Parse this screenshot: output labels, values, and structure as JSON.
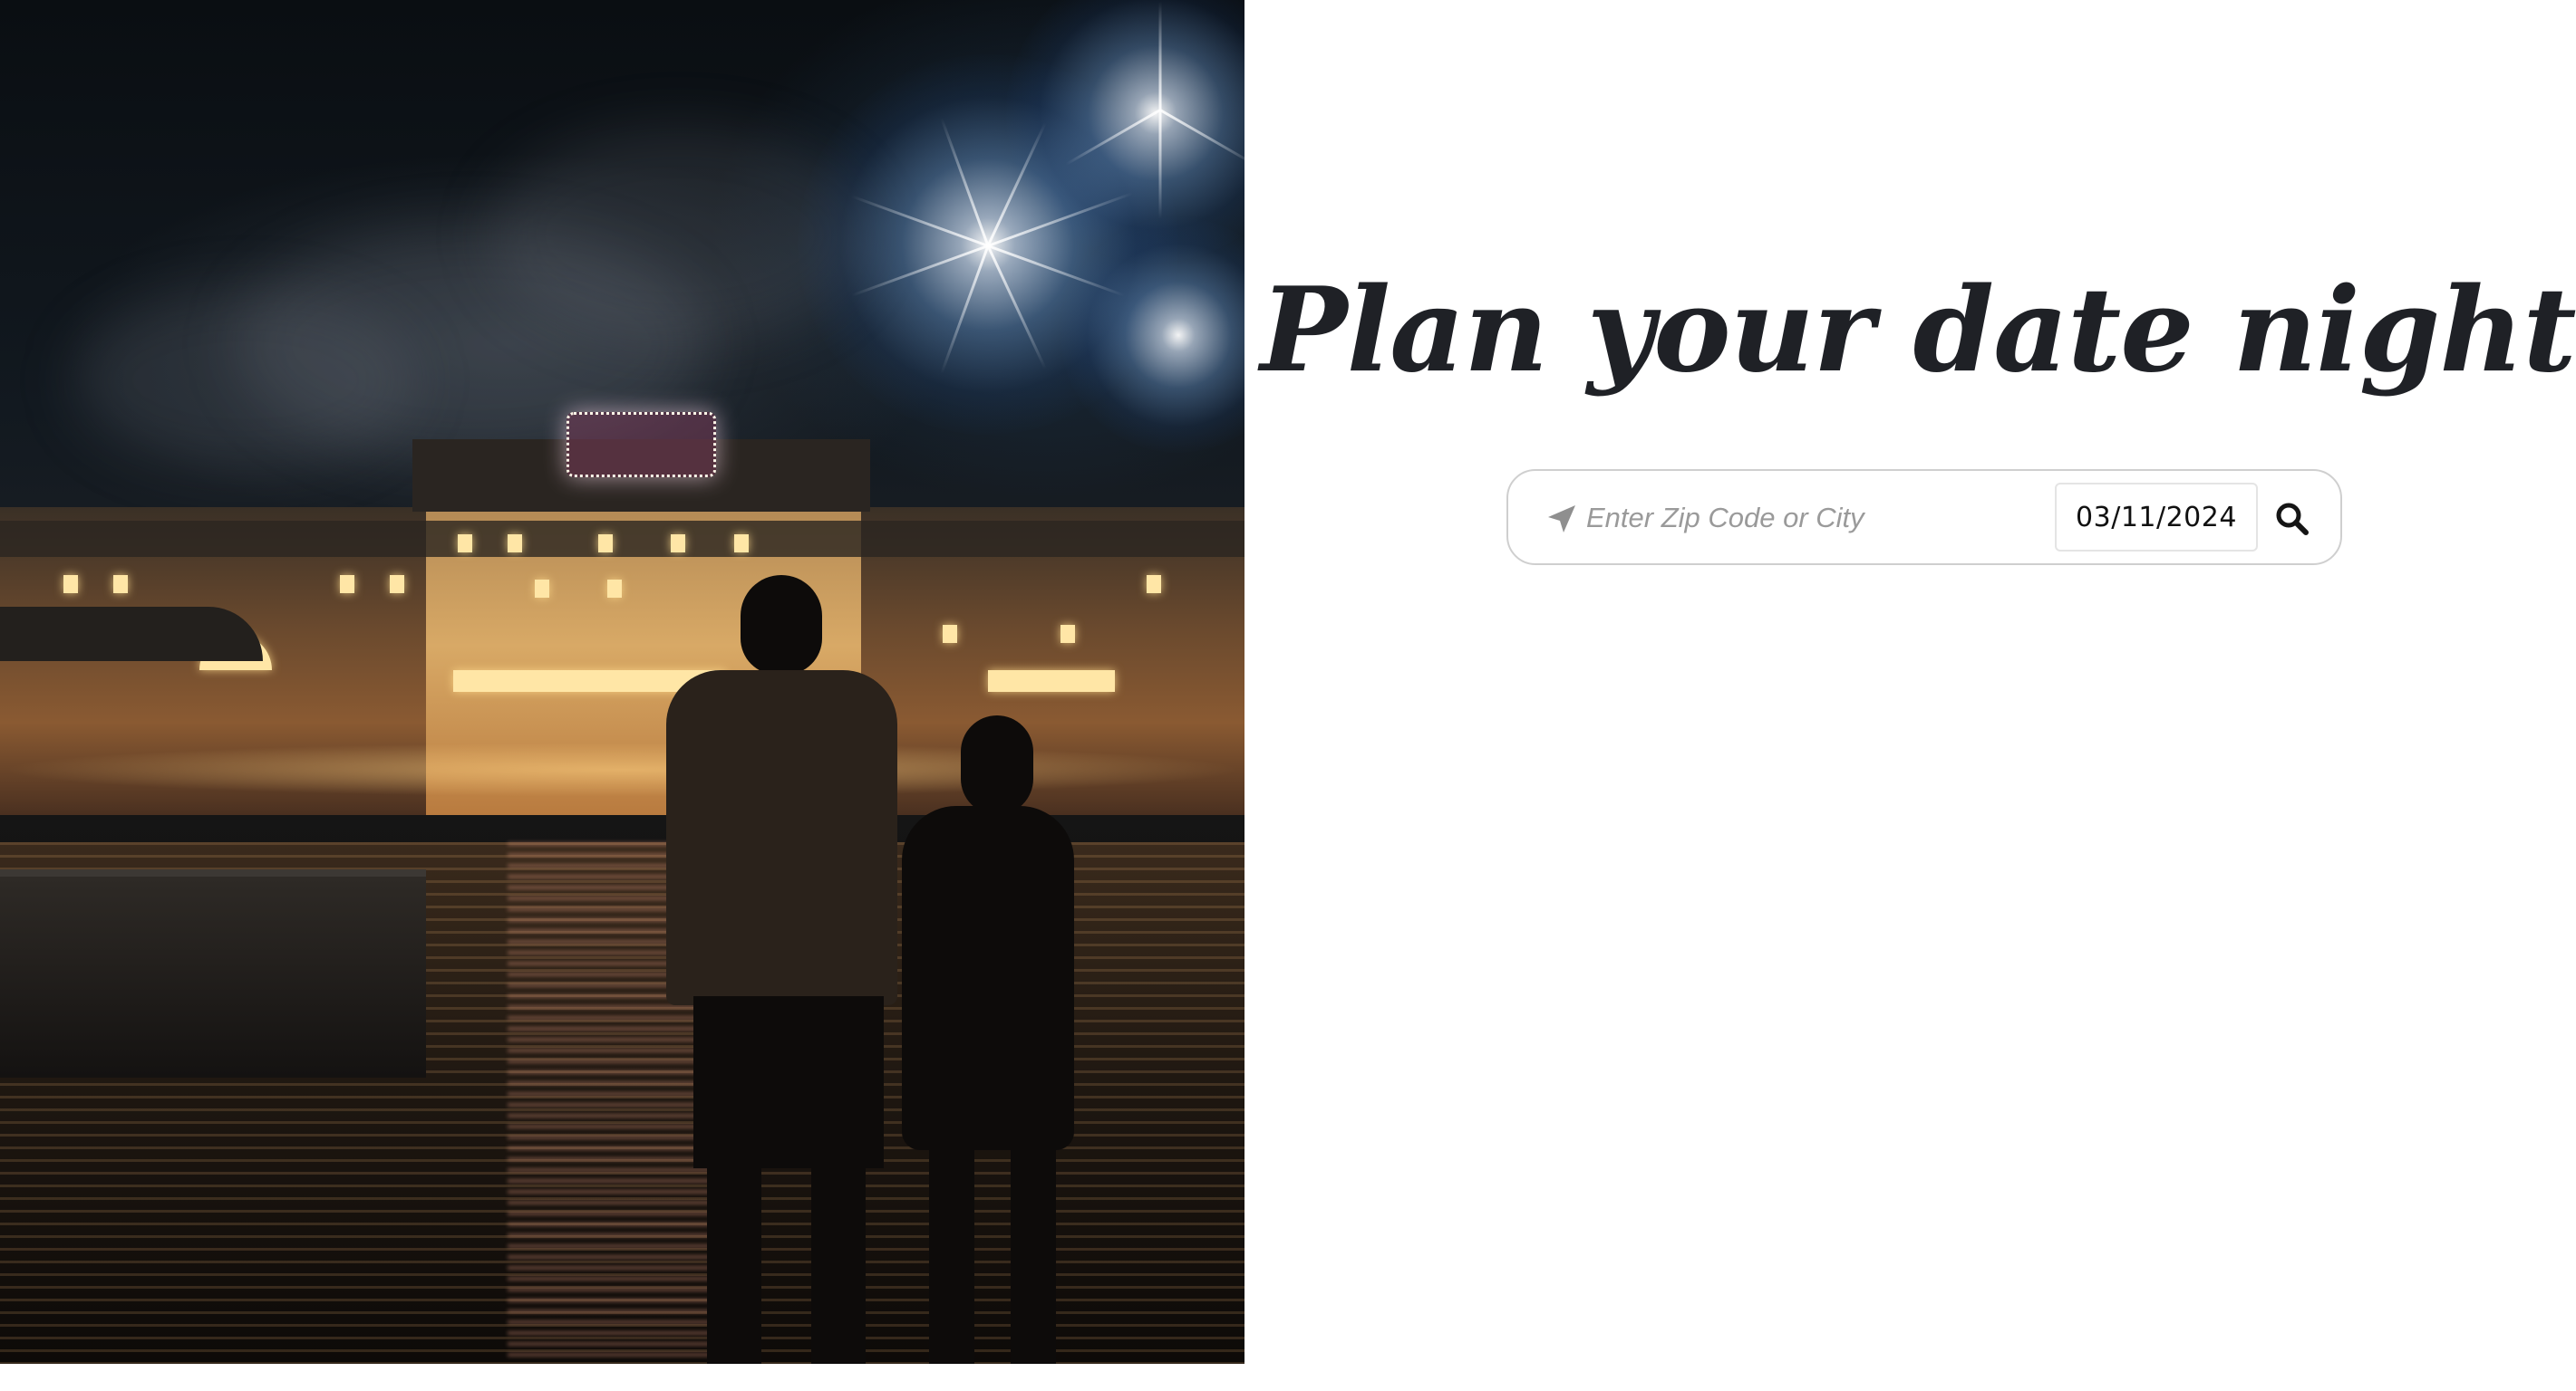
{
  "hero": {
    "image_alt": "Couple watching fireworks over a lit waterfront boardwalk hotel at night",
    "icon": "photo-image"
  },
  "headline": {
    "title": "Plan your date night"
  },
  "search": {
    "location_icon": "location-arrow-icon",
    "placeholder": "Enter Zip Code or City",
    "date_value": "03/11/2024",
    "submit_icon": "search-icon"
  },
  "colors": {
    "headline": "#1f2126",
    "search_border": "#cfcfcf",
    "placeholder": "#9a9a9a",
    "background": "#ffffff"
  }
}
